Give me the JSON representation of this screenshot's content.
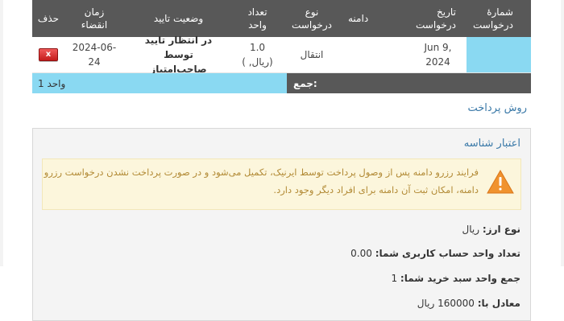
{
  "table": {
    "headers": {
      "order": [
        "شمارهٔ",
        "درخواست"
      ],
      "date": [
        "تاریخ",
        "درخواست"
      ],
      "domain": "دامنه",
      "type": [
        "نوع",
        "درخواست"
      ],
      "units": [
        "تعداد",
        "واحد"
      ],
      "status": "وضعیت تایید",
      "expiry": "زمان انقضاء",
      "delete": "حذف"
    },
    "row": {
      "order": "",
      "date": [
        "Jun 9,",
        "2024"
      ],
      "domain": "",
      "type": "انتقال",
      "units": [
        "1.0",
        "(ریال, )"
      ],
      "status": [
        "در انتظار تایید توسط",
        "صاحب‌امتیاز"
      ],
      "expiry": "2024-06-24",
      "delete_icon": "x"
    },
    "total": {
      "label": "جمع:",
      "value": "1 واحد"
    }
  },
  "payment_method_link": "روش پرداخت",
  "panel": {
    "title": "اعتبار شناسه",
    "alert": {
      "icon": "warning-triangle",
      "lines": [
        "فرایند رزرو دامنه پس از وصول پرداخت توسط ایرنیک، تکمیل می‌شود و در صورت پرداخت نشدن درخواست رزرو",
        "دامنه، امکان ثبت آن دامنه برای افراد دیگر وجود دارد."
      ]
    },
    "currency": {
      "label": "نوع ارز:",
      "value": "ریال"
    },
    "account_units": {
      "label": "تعداد واحد حساب کاربری شما:",
      "value": "0.00"
    },
    "cart_units": {
      "label": "جمع واحد سبد خرید شما:",
      "value": "1"
    },
    "equivalent": {
      "label": "معادل با:",
      "value": "160000 ریال"
    }
  },
  "colors": {
    "header_bg": "#585858",
    "highlight": "#8ad9f2",
    "link": "#3a79a8",
    "alert_bg": "#fcf6dc",
    "alert_text": "#b28a35",
    "delete_red": "#d32f2f",
    "warning_orange": "#f0922e"
  }
}
